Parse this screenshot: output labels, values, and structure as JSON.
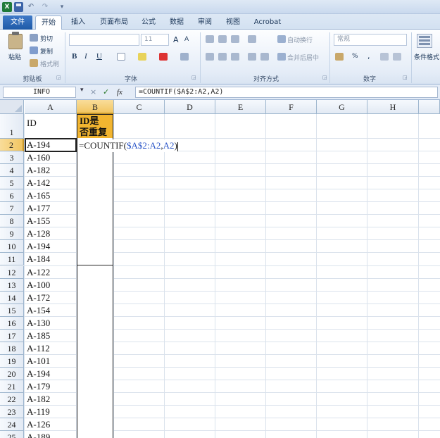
{
  "qat": {
    "excel_icon": "X",
    "undo": "↶",
    "redo": "↷",
    "customize": "▾"
  },
  "tabs": [
    "文件",
    "开始",
    "插入",
    "页面布局",
    "公式",
    "数据",
    "审阅",
    "视图",
    "Acrobat"
  ],
  "ribbon": {
    "clipboard": {
      "paste": "粘贴",
      "cut": "剪切",
      "copy": "复制",
      "format_painter": "格式刷",
      "label": "剪贴板"
    },
    "font": {
      "size": "11",
      "grow": "A",
      "shrink": "A",
      "bold": "B",
      "italic": "I",
      "underline": "U",
      "label": "字体"
    },
    "alignment": {
      "wrap_text": "自动换行",
      "merge_center": "合并后居中",
      "label": "对齐方式"
    },
    "number": {
      "format": "常规",
      "percent": "%",
      "comma": ",",
      "label": "数字"
    },
    "styles": {
      "conditional_format": "条件格式"
    }
  },
  "formula_bar": {
    "name_box": "INFO",
    "cancel": "×",
    "enter": "✓",
    "fx": "fx",
    "formula": "=COUNTIF($A$2:A2,A2)"
  },
  "grid": {
    "columns": [
      "A",
      "B",
      "C",
      "D",
      "E",
      "F",
      "G",
      "H"
    ],
    "rows": [
      "1",
      "2",
      "3",
      "4",
      "5",
      "6",
      "7",
      "8",
      "9",
      "10",
      "11",
      "12",
      "13",
      "14",
      "15",
      "16",
      "17",
      "18",
      "19",
      "20",
      "21",
      "22",
      "23",
      "24",
      "25"
    ],
    "header_a": "ID",
    "header_b_line1": "ID是",
    "header_b_line2": "否重复",
    "ids": [
      "A-194",
      "A-160",
      "A-182",
      "A-142",
      "A-165",
      "A-177",
      "A-155",
      "A-128",
      "A-194",
      "A-184",
      "A-122",
      "A-100",
      "A-172",
      "A-154",
      "A-130",
      "A-185",
      "A-112",
      "A-101",
      "A-194",
      "A-179",
      "A-182",
      "A-119",
      "A-126",
      "A-189"
    ],
    "editing": {
      "prefix": "=COUNTIF(",
      "range": "$A$2:A2",
      "sep": ",",
      "arg": "A2",
      "suffix": ")"
    }
  }
}
